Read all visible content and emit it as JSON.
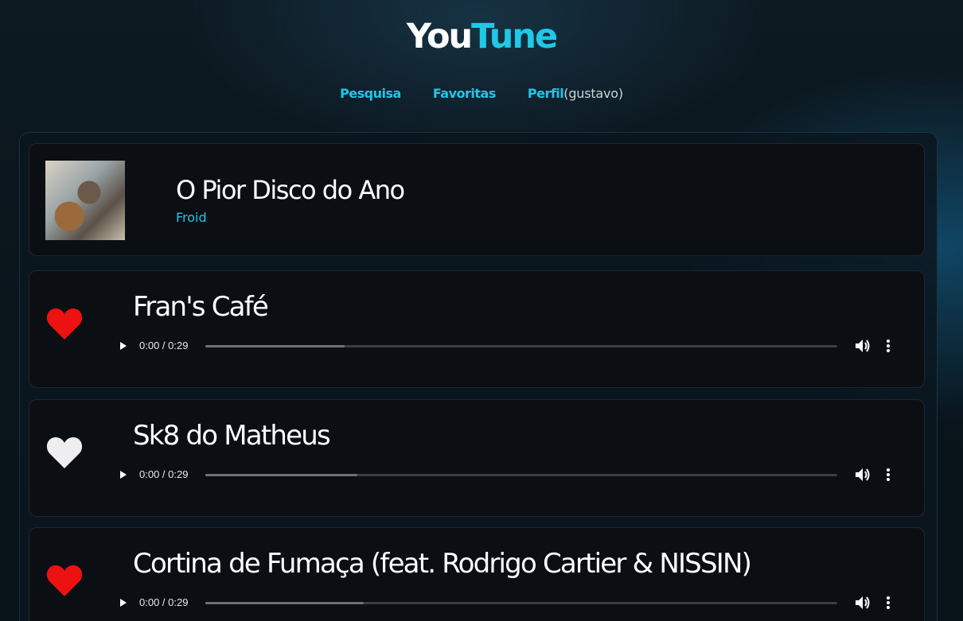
{
  "app": {
    "logo_you": "You",
    "logo_tune": "Tune"
  },
  "nav": {
    "search": "Pesquisa",
    "favorites": "Favoritas",
    "profile": "Perfil",
    "user": "(gustavo)"
  },
  "album": {
    "title": "O Pior Disco do Ano",
    "artist": "Froid"
  },
  "tracks": [
    {
      "name": "Fran's Café",
      "favorite": true,
      "time": "0:00 / 0:29",
      "progress_fraction": 0.22
    },
    {
      "name": "Sk8 do Matheus",
      "favorite": false,
      "time": "0:00 / 0:29",
      "progress_fraction": 0.24
    },
    {
      "name": "Cortina de Fumaça (feat. Rodrigo Cartier & NISSIN)",
      "favorite": true,
      "time": "0:00 / 0:29",
      "progress_fraction": 0.25
    }
  ],
  "colors": {
    "accent": "#1ec8e8",
    "heart_on": "#ee1111",
    "heart_off": "#eeeeee"
  },
  "icons": {
    "heart": "heart-icon",
    "play": "play-icon",
    "volume": "volume-icon",
    "more": "more-vertical-icon"
  }
}
